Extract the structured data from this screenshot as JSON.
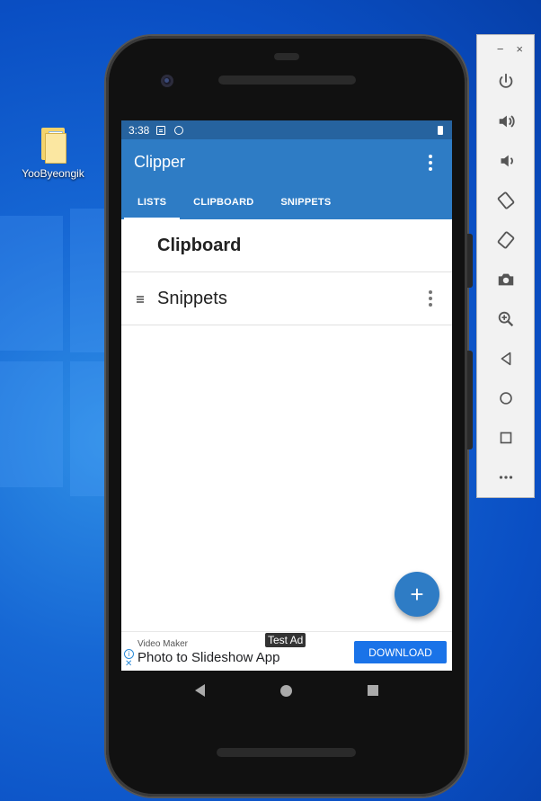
{
  "desktop": {
    "icon_label": "YooByeongik"
  },
  "device": {
    "status_bar": {
      "time": "3:38"
    },
    "app": {
      "title": "Clipper",
      "tabs": [
        {
          "label": "LISTS",
          "active": true
        },
        {
          "label": "CLIPBOARD",
          "active": false
        },
        {
          "label": "SNIPPETS",
          "active": false
        }
      ],
      "lists": [
        {
          "name": "Clipboard"
        },
        {
          "name": "Snippets"
        }
      ],
      "fab_label": "+"
    },
    "ad": {
      "badge": "Test Ad",
      "advertiser": "Video Maker",
      "headline": "Photo to Slideshow App",
      "cta": "DOWNLOAD"
    }
  },
  "emulator_toolbar": {
    "window_controls": [
      "−",
      "×"
    ],
    "buttons": [
      {
        "icon": "power-icon"
      },
      {
        "icon": "volume-up-icon"
      },
      {
        "icon": "volume-down-icon"
      },
      {
        "icon": "rotate-left-icon"
      },
      {
        "icon": "rotate-right-icon"
      },
      {
        "icon": "camera-icon"
      },
      {
        "icon": "zoom-icon"
      },
      {
        "icon": "back-icon"
      },
      {
        "icon": "home-icon"
      },
      {
        "icon": "overview-icon"
      },
      {
        "icon": "more-icon"
      }
    ]
  },
  "colors": {
    "app_bar": "#2e7cc5",
    "status_bar": "#26639f",
    "download_button": "#1a73e8"
  }
}
